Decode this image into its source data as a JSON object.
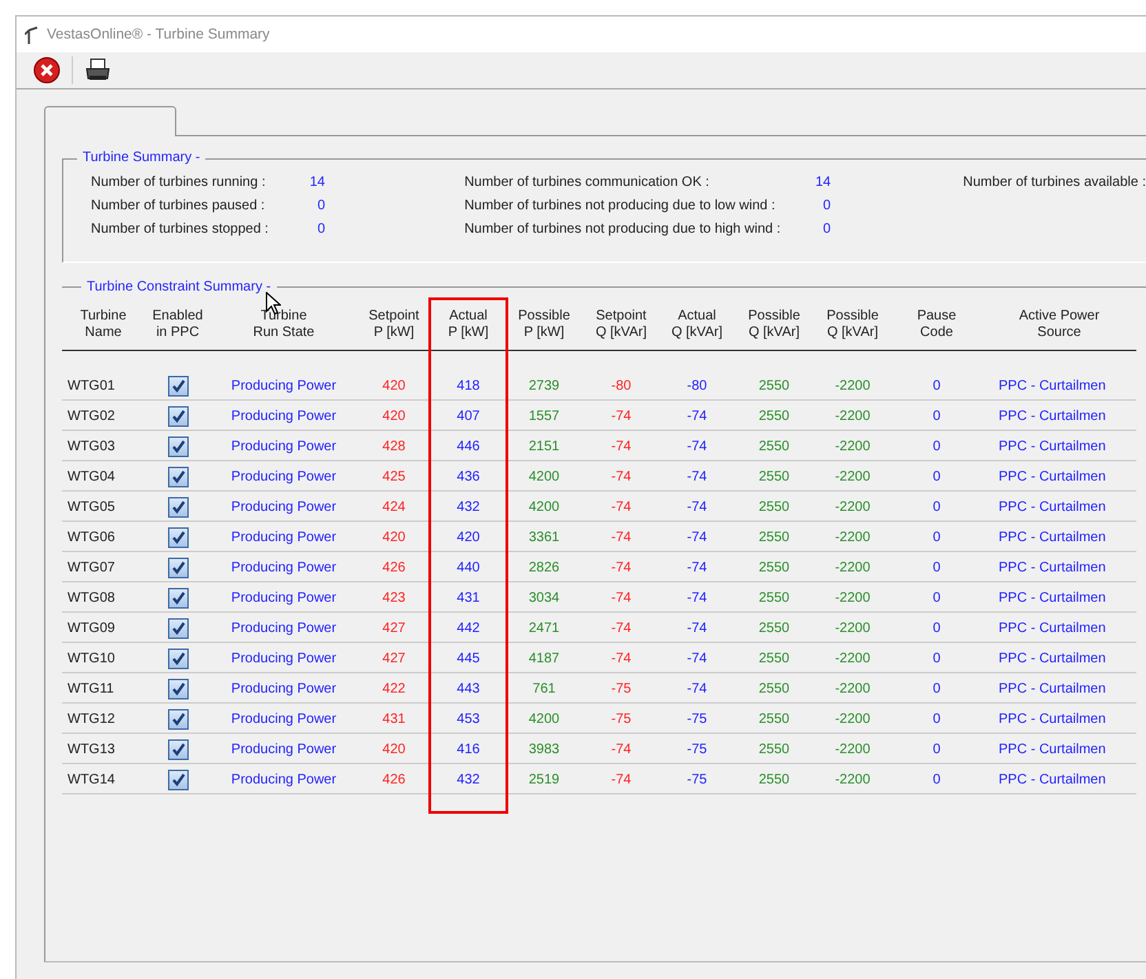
{
  "window": {
    "title": "VestasOnline® - Turbine Summary"
  },
  "toolbar": [
    {
      "kind": "close"
    },
    {
      "kind": "print"
    }
  ],
  "turbine_summary": {
    "title": "Turbine Summary -",
    "groups": [
      [
        {
          "label": "Number of turbines running :",
          "value": "14"
        },
        {
          "label": "Number of turbines paused :",
          "value": "0"
        },
        {
          "label": "Number of turbines stopped :",
          "value": "0"
        }
      ],
      [
        {
          "label": "Number of turbines communication OK :",
          "value": "14"
        },
        {
          "label": "Number of turbines not producing due to low wind :",
          "value": "0"
        },
        {
          "label": "Number of turbines not producing due to high wind :",
          "value": "0"
        }
      ],
      [
        {
          "label": "Number of turbines available :"
        }
      ]
    ]
  },
  "constraint_summary": {
    "title": "Turbine Constraint Summary -",
    "columns": [
      {
        "label": "Turbine\nName",
        "kind": "text"
      },
      {
        "label": "Enabled\nin PPC",
        "kind": "check"
      },
      {
        "label": "Turbine\nRun State",
        "kind": "text",
        "color": "#1f1fff"
      },
      {
        "label": "Setpoint\nP [kW]",
        "kind": "text",
        "color": "#ff2424"
      },
      {
        "label": "Actual\nP [kW]",
        "kind": "text",
        "color": "#1f1fff",
        "highlighted": true
      },
      {
        "label": "Possible\nP [kW]",
        "kind": "text",
        "color": "#2a8f2a"
      },
      {
        "label": "Setpoint\nQ [kVAr]",
        "kind": "text",
        "color": "#ff2424"
      },
      {
        "label": "Actual\nQ [kVAr]",
        "kind": "text",
        "color": "#1f1fff"
      },
      {
        "label": "Possible\nQ [kVAr]",
        "kind": "text",
        "color": "#2a8f2a"
      },
      {
        "label": "Possible\nQ [kVAr]",
        "kind": "text",
        "color": "#2a8f2a"
      },
      {
        "label": "Pause\nCode",
        "kind": "text",
        "color": "#1f1fff"
      },
      {
        "label": "Active Power\nSource",
        "kind": "text",
        "color": "#1f1fff"
      }
    ],
    "rows": [
      {
        "cells": [
          "WTG01",
          true,
          "Producing Power",
          "420",
          "418",
          "2739",
          "-80",
          "-80",
          "2550",
          "-2200",
          "0",
          "PPC - Curtailmen"
        ]
      },
      {
        "cells": [
          "WTG02",
          true,
          "Producing Power",
          "420",
          "407",
          "1557",
          "-74",
          "-74",
          "2550",
          "-2200",
          "0",
          "PPC - Curtailmen"
        ]
      },
      {
        "cells": [
          "WTG03",
          true,
          "Producing Power",
          "428",
          "446",
          "2151",
          "-74",
          "-74",
          "2550",
          "-2200",
          "0",
          "PPC - Curtailmen"
        ]
      },
      {
        "cells": [
          "WTG04",
          true,
          "Producing Power",
          "425",
          "436",
          "4200",
          "-74",
          "-74",
          "2550",
          "-2200",
          "0",
          "PPC - Curtailmen"
        ]
      },
      {
        "cells": [
          "WTG05",
          true,
          "Producing Power",
          "424",
          "432",
          "4200",
          "-74",
          "-74",
          "2550",
          "-2200",
          "0",
          "PPC - Curtailmen"
        ]
      },
      {
        "cells": [
          "WTG06",
          true,
          "Producing Power",
          "420",
          "420",
          "3361",
          "-74",
          "-74",
          "2550",
          "-2200",
          "0",
          "PPC - Curtailmen"
        ]
      },
      {
        "cells": [
          "WTG07",
          true,
          "Producing Power",
          "426",
          "440",
          "2826",
          "-74",
          "-74",
          "2550",
          "-2200",
          "0",
          "PPC - Curtailmen"
        ]
      },
      {
        "cells": [
          "WTG08",
          true,
          "Producing Power",
          "423",
          "431",
          "3034",
          "-74",
          "-74",
          "2550",
          "-2200",
          "0",
          "PPC - Curtailmen"
        ]
      },
      {
        "cells": [
          "WTG09",
          true,
          "Producing Power",
          "427",
          "442",
          "2471",
          "-74",
          "-74",
          "2550",
          "-2200",
          "0",
          "PPC - Curtailmen"
        ]
      },
      {
        "cells": [
          "WTG10",
          true,
          "Producing Power",
          "427",
          "445",
          "4187",
          "-74",
          "-74",
          "2550",
          "-2200",
          "0",
          "PPC - Curtailmen"
        ]
      },
      {
        "cells": [
          "WTG11",
          true,
          "Producing Power",
          "422",
          "443",
          "761",
          "-75",
          "-74",
          "2550",
          "-2200",
          "0",
          "PPC - Curtailmen"
        ]
      },
      {
        "cells": [
          "WTG12",
          true,
          "Producing Power",
          "431",
          "453",
          "4200",
          "-75",
          "-75",
          "2550",
          "-2200",
          "0",
          "PPC - Curtailmen"
        ]
      },
      {
        "cells": [
          "WTG13",
          true,
          "Producing Power",
          "420",
          "416",
          "3983",
          "-74",
          "-75",
          "2550",
          "-2200",
          "0",
          "PPC - Curtailmen"
        ]
      },
      {
        "cells": [
          "WTG14",
          true,
          "Producing Power",
          "426",
          "432",
          "2519",
          "-74",
          "-75",
          "2550",
          "-2200",
          "0",
          "PPC - Curtailmen"
        ]
      }
    ]
  }
}
